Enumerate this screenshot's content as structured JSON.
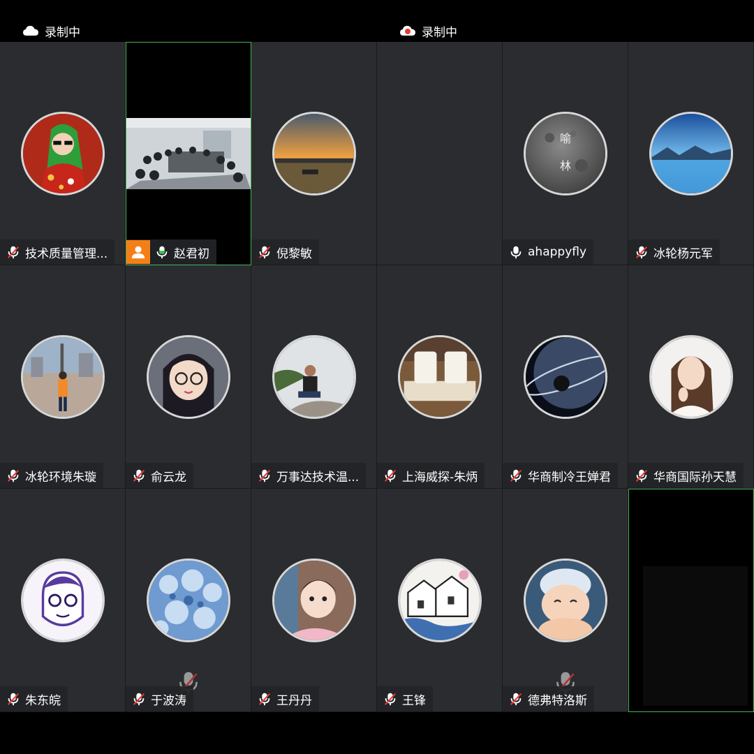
{
  "status": {
    "left_text": "录制中",
    "right_text": "录制中",
    "recording_color": "#e53935"
  },
  "participants": [
    {
      "name": "技术质量管理...",
      "mic": "muted",
      "avatar": "cartoon-girl-green-hood"
    },
    {
      "name": "赵君初",
      "mic": "on",
      "video": "meeting-room",
      "host": true,
      "active_speaker": true
    },
    {
      "name": "倪黎敏",
      "mic": "muted",
      "avatar": "sunset-harbor"
    },
    {
      "name": "",
      "mic": "none",
      "avatar": "none"
    },
    {
      "name": "ahappyfly",
      "mic": "on",
      "avatar": "moon-with-text",
      "avatar_text": [
        "喻",
        "林"
      ]
    },
    {
      "name": "冰轮杨元军",
      "mic": "muted",
      "avatar": "lake-mountains"
    },
    {
      "name": "冰轮环境朱璇",
      "mic": "muted",
      "avatar": "person-city-square"
    },
    {
      "name": "俞云龙",
      "mic": "muted",
      "avatar": "anime-girl-glasses"
    },
    {
      "name": "万事达技术温...",
      "mic": "muted",
      "avatar": "man-on-rock"
    },
    {
      "name": "上海威探-朱炳",
      "mic": "muted",
      "avatar": "tea-cups"
    },
    {
      "name": "华商制冷王婵君",
      "mic": "muted",
      "avatar": "planet-rings"
    },
    {
      "name": "华商国际孙天慧",
      "mic": "muted",
      "avatar": "woman-portrait"
    },
    {
      "name": "朱东皖",
      "mic": "muted",
      "avatar": "man-glasses-sketch"
    },
    {
      "name": "于波涛",
      "mic": "muted",
      "avatar": "frost-blue"
    },
    {
      "name": "王丹丹",
      "mic": "muted",
      "avatar": "baby-girl"
    },
    {
      "name": "王锋",
      "mic": "muted",
      "avatar": "sketch-village"
    },
    {
      "name": "德弗特洛斯",
      "mic": "muted",
      "avatar": "bun-doll"
    },
    {
      "name": "",
      "mic": "none",
      "video": "dark",
      "active_speaker": true
    }
  ]
}
